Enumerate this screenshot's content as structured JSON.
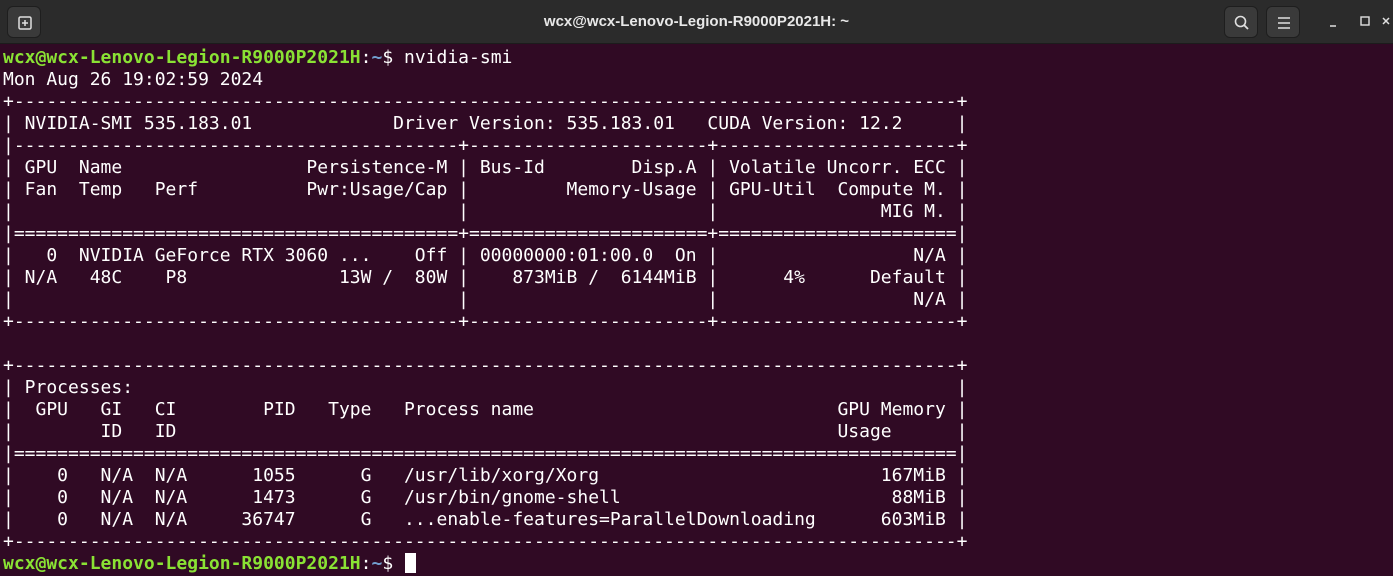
{
  "window": {
    "title": "wcx@wcx-Lenovo-Legion-R9000P2021H: ~"
  },
  "icons": {
    "new_tab": "new-tab-icon",
    "search": "search-icon",
    "menu": "hamburger-menu-icon",
    "minimize": "minimize-icon",
    "maximize": "maximize-icon",
    "close": "close-icon"
  },
  "colors": {
    "background": "#300a24",
    "prompt_user": "#8ae234",
    "prompt_path": "#729fcf",
    "titlebar": "#2b2b2b"
  },
  "prompt": {
    "user_host": "wcx@wcx-Lenovo-Legion-R9000P2021H",
    "separator": ":",
    "path": "~",
    "symbol": "$ "
  },
  "command": "nvidia-smi",
  "output_lines": [
    "Mon Aug 26 19:02:59 2024",
    "+---------------------------------------------------------------------------------------+",
    "| NVIDIA-SMI 535.183.01             Driver Version: 535.183.01   CUDA Version: 12.2     |",
    "|-----------------------------------------+----------------------+----------------------+",
    "| GPU  Name                 Persistence-M | Bus-Id        Disp.A | Volatile Uncorr. ECC |",
    "| Fan  Temp   Perf          Pwr:Usage/Cap |         Memory-Usage | GPU-Util  Compute M. |",
    "|                                         |                      |               MIG M. |",
    "|=========================================+======================+======================|",
    "|   0  NVIDIA GeForce RTX 3060 ...    Off | 00000000:01:00.0  On |                  N/A |",
    "| N/A   48C    P8              13W /  80W |    873MiB /  6144MiB |      4%      Default |",
    "|                                         |                      |                  N/A |",
    "+-----------------------------------------+----------------------+----------------------+",
    "",
    "+---------------------------------------------------------------------------------------+",
    "| Processes:                                                                            |",
    "|  GPU   GI   CI        PID   Type   Process name                            GPU Memory |",
    "|        ID   ID                                                             Usage      |",
    "|=======================================================================================|",
    "|    0   N/A  N/A      1055      G   /usr/lib/xorg/Xorg                          167MiB |",
    "|    0   N/A  N/A      1473      G   /usr/bin/gnome-shell                         88MiB |",
    "|    0   N/A  N/A     36747      G   ...enable-features=ParallelDownloading      603MiB |",
    "+---------------------------------------------------------------------------------------+"
  ]
}
